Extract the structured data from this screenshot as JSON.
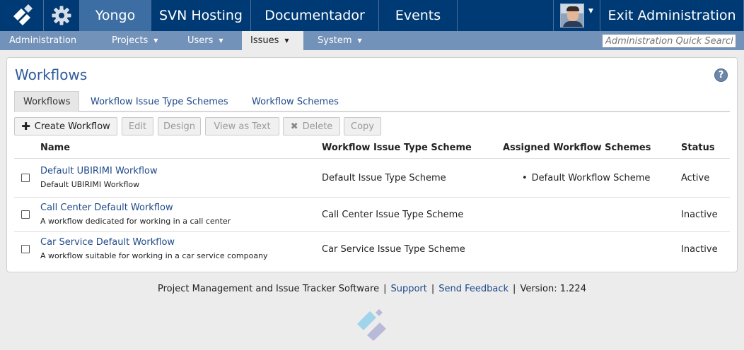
{
  "topnav": {
    "items": [
      "Yongo",
      "SVN Hosting",
      "Documentador",
      "Events"
    ],
    "exit_label": "Exit Administration"
  },
  "subnav": {
    "items": [
      "Administration",
      "Projects",
      "Users",
      "Issues",
      "System"
    ],
    "active": "Issues",
    "search_placeholder": "Administration Quick Search"
  },
  "page": {
    "title": "Workflows",
    "help": "?"
  },
  "tabs": [
    "Workflows",
    "Workflow Issue Type Schemes",
    "Workflow Schemes"
  ],
  "toolbar": {
    "create": "Create Workflow",
    "edit": "Edit",
    "design": "Design",
    "view_text": "View as Text",
    "delete": "Delete",
    "copy": "Copy"
  },
  "table": {
    "headers": {
      "name": "Name",
      "scheme": "Workflow Issue Type Scheme",
      "assigned": "Assigned Workflow Schemes",
      "status": "Status"
    },
    "rows": [
      {
        "name": "Default UBIRIMI Workflow",
        "description": "Default UBIRIMI Workflow",
        "scheme": "Default Issue Type Scheme",
        "assigned": "Default Workflow Scheme",
        "status": "Active"
      },
      {
        "name": "Call Center Default Workflow",
        "description": "A workflow dedicated for working in a call center",
        "scheme": "Call Center Issue Type Scheme",
        "assigned": "",
        "status": "Inactive"
      },
      {
        "name": "Car Service Default Workflow",
        "description": "A workflow suitable for working in a car service compoany",
        "scheme": "Car Service Issue Type Scheme",
        "assigned": "",
        "status": "Inactive"
      }
    ]
  },
  "footer": {
    "text": "Project Management and Issue Tracker Software",
    "support": "Support",
    "feedback": "Send Feedback",
    "version": "Version: 1.224",
    "separator": "|"
  },
  "icons": {
    "logo": "ubirimi-logo-icon",
    "settings": "gear-icon",
    "user": "avatar",
    "dropdown": "caret-down-icon",
    "help": "help-icon",
    "create": "plus-icon",
    "delete": "x-icon"
  },
  "colors": {
    "topbar": "#003a75",
    "topbar_active": "#3d6ea3",
    "subnav": "#7292b9",
    "link": "#1f4a8a",
    "title": "#2e5c9a"
  }
}
